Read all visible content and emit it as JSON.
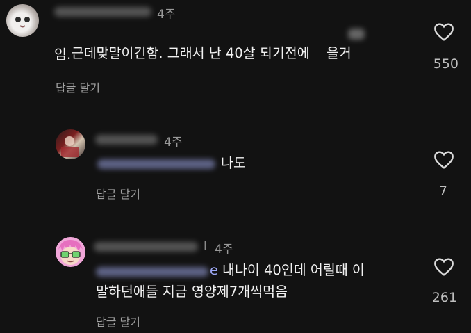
{
  "comments": [
    {
      "time": "4주",
      "text_line1_before": "근데맞말이긴함. 그래서 난 40살 되기전에 ",
      "text_line1_partial": "을거",
      "text_line2": "임.",
      "reply_label": "답글 달기",
      "like_count": "550"
    },
    {
      "time": "4주",
      "text": "나도",
      "reply_label": "답글 달기",
      "like_count": "7"
    },
    {
      "username_suffix": "l",
      "time": "4주",
      "mention_suffix": "e",
      "text_line1": "내나이 40인데 어릴때 이",
      "text_line2": "말하던애들 지금 영양제7개씩먹음",
      "reply_label": "답글 달기",
      "like_count": "261"
    }
  ],
  "icons": {
    "like": "heart-outline-icon"
  },
  "colors": {
    "background": "#121212",
    "mention": "#9da8f5"
  }
}
